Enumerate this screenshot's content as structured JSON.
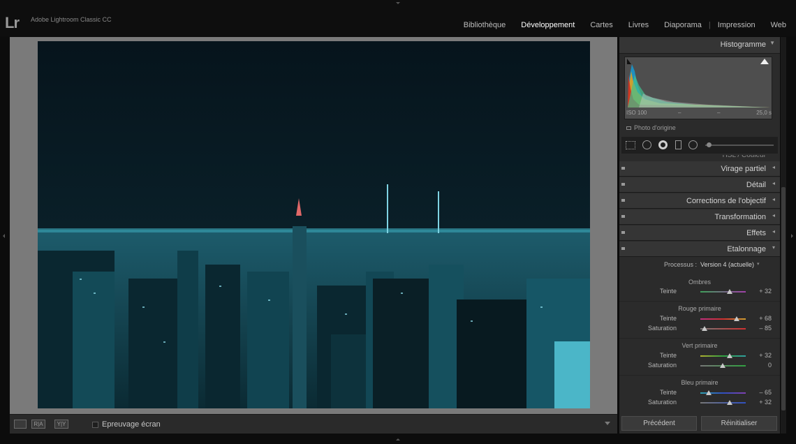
{
  "app": {
    "logo": "Lr",
    "title": "Adobe Lightroom Classic CC"
  },
  "modules": [
    {
      "label": "Bibliothèque"
    },
    {
      "label": "Développement"
    },
    {
      "label": "Cartes"
    },
    {
      "label": "Livres"
    },
    {
      "label": "Diaporama"
    },
    {
      "label": "Impression"
    },
    {
      "label": "Web"
    }
  ],
  "active_module": "Développement",
  "histogram": {
    "title": "Histogramme",
    "iso": "ISO 100",
    "dash1": "–",
    "dash2": "–",
    "shutter": "25,0 s",
    "original_label": "Photo d'origine"
  },
  "panels": {
    "hsl_partial": "HSL / Couleur",
    "split_toning": "Virage partiel",
    "detail": "Détail",
    "lens": "Corrections de l'objectif",
    "transform": "Transformation",
    "effects": "Effets",
    "calibration": "Etalonnage"
  },
  "calibration": {
    "process_label": "Processus :",
    "process_value": "Version 4 (actuelle)",
    "shadows": {
      "title": "Ombres",
      "tint_label": "Teinte",
      "tint": "+ 32"
    },
    "red": {
      "title": "Rouge primaire",
      "hue_label": "Teinte",
      "hue": "+ 68",
      "sat_label": "Saturation",
      "sat": "– 85"
    },
    "green": {
      "title": "Vert primaire",
      "hue_label": "Teinte",
      "hue": "+ 32",
      "sat_label": "Saturation",
      "sat": "0"
    },
    "blue": {
      "title": "Bleu primaire",
      "hue_label": "Teinte",
      "hue": "– 65",
      "sat_label": "Saturation",
      "sat": "+ 32"
    }
  },
  "buttons": {
    "previous": "Précédent",
    "reset": "Réinitialiser"
  },
  "toolbar": {
    "soft_proof": "Epreuvage écran",
    "ref_label": "R|A",
    "yy_label": "Y|Y"
  },
  "colors": {
    "accent": "#ffffff",
    "panel_bg": "#2b2b2b",
    "photo_tint": "#2aa9c4"
  },
  "icons": [
    "crop-icon",
    "spot-removal-icon",
    "red-eye-icon",
    "graduated-filter-icon",
    "radial-filter-icon",
    "brush-slider-icon",
    "loupe-view-icon",
    "before-after-icon",
    "checkbox-icon",
    "panel-collapse-icon"
  ]
}
